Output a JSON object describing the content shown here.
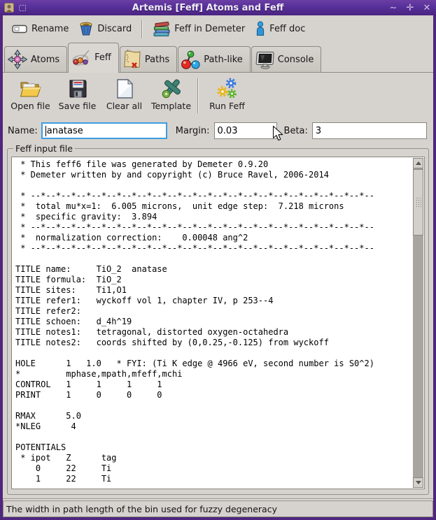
{
  "window": {
    "title": "Artemis [Feff] Atoms and Feff",
    "minimize_glyph": "∼",
    "maximize_glyph": "✛",
    "close_glyph": "✕"
  },
  "toolbar_top": {
    "rename": "Rename",
    "discard": "Discard",
    "feff_in_demeter": "Feff in Demeter",
    "feff_doc": "Feff doc"
  },
  "tabs": {
    "atoms": "Atoms",
    "feff": "Feff",
    "paths": "Paths",
    "path_like": "Path-like",
    "console": "Console",
    "active_tab": "Feff"
  },
  "feff_toolbar": {
    "open_file": "Open file",
    "save_file": "Save file",
    "clear_all": "Clear all",
    "template": "Template",
    "run_feff": "Run Feff"
  },
  "fields": {
    "name_label": "Name:",
    "name_value": "anatase",
    "margin_label": "Margin:",
    "margin_value": "0.03",
    "beta_label": "Beta:",
    "beta_value": "3"
  },
  "feff_input": {
    "group_label": "Feff input file",
    "content": " * This feff6 file was generated by Demeter 0.9.20\n * Demeter written by and copyright (c) Bruce Ravel, 2006-2014\n\n * --*--*--*--*--*--*--*--*--*--*--*--*--*--*--*--*--*--*--*--*--*--*--\n *  total mu*x=1:  6.005 microns,  unit edge step:  7.218 microns\n *  specific gravity:  3.894\n * --*--*--*--*--*--*--*--*--*--*--*--*--*--*--*--*--*--*--*--*--*--*--\n *  normalization correction:    0.00048 ang^2\n * --*--*--*--*--*--*--*--*--*--*--*--*--*--*--*--*--*--*--*--*--*--*--\n\nTITLE name:     TiO_2  anatase\nTITLE formula:  TiO_2\nTITLE sites:    Ti1,O1\nTITLE refer1:   wyckoff vol 1, chapter IV, p 253--4\nTITLE refer2:\nTITLE schoen:   d_4h^19\nTITLE notes1:   tetragonal, distorted oxygen-octahedra\nTITLE notes2:   coords shifted by (0,0.25,-0.125) from wyckoff\n\nHOLE      1   1.0   * FYI: (Ti K edge @ 4966 eV, second number is S0^2)\n*         mphase,mpath,mfeff,mchi\nCONTROL   1     1     1     1\nPRINT     1     0     0     0\n\nRMAX      5.0\n*NLEG      4\n\nPOTENTIALS\n * ipot   Z      tag\n    0     22     Ti\n    1     22     Ti"
  },
  "statusbar": {
    "text": "The width in path length of the bin used for fuzzy degeneracy"
  },
  "colors": {
    "titlebar_purple": "#57309a",
    "focus_ring_blue": "#3d9de2",
    "panel_gray": "#d6d2cd"
  }
}
